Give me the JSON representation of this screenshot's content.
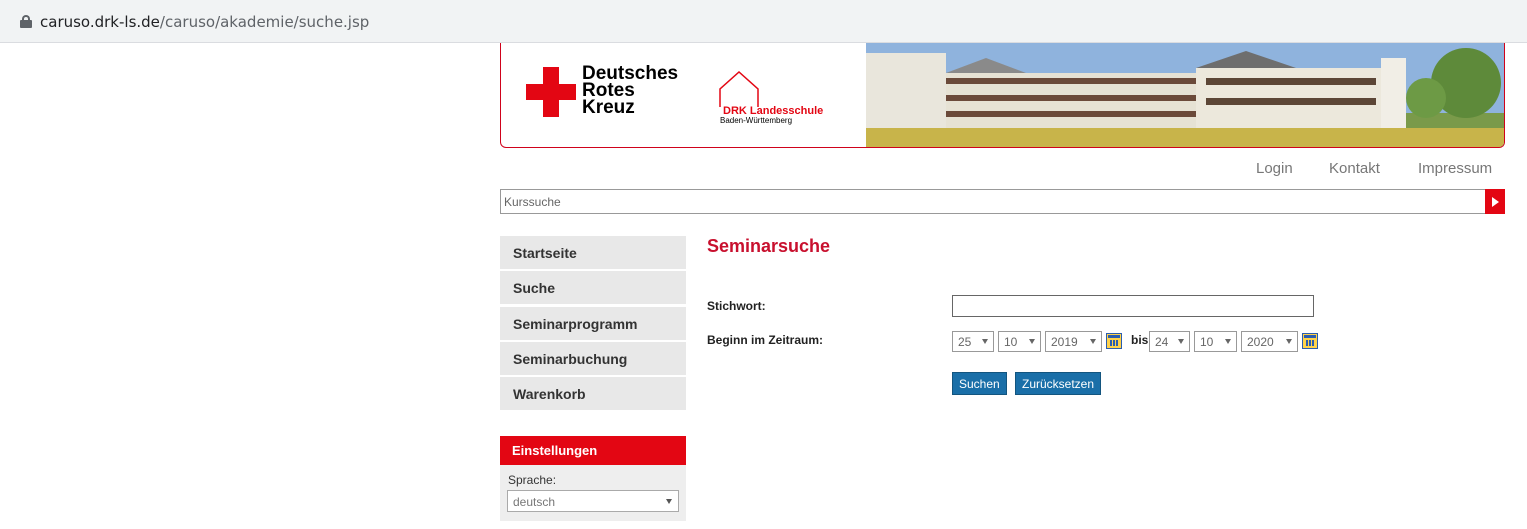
{
  "browser": {
    "url_domain": "caruso.drk-ls.de",
    "url_path": "/caruso/akademie/suche.jsp"
  },
  "header": {
    "org_line1": "Deutsches",
    "org_line2": "Rotes",
    "org_line3": "Kreuz",
    "school_name": "DRK Landesschule",
    "school_region": "Baden-Württemberg",
    "brand_color": "#e30613"
  },
  "top_links": {
    "login": "Login",
    "contact": "Kontakt",
    "imprint": "Impressum"
  },
  "search": {
    "placeholder": "Kurssuche"
  },
  "sidebar": {
    "items": [
      {
        "label": "Startseite"
      },
      {
        "label": "Suche"
      },
      {
        "label": "Seminarprogramm"
      },
      {
        "label": "Seminarbuchung"
      },
      {
        "label": "Warenkorb"
      }
    ],
    "settings": {
      "title": "Einstellungen",
      "language_label": "Sprache:",
      "language_value": "deutsch"
    }
  },
  "main": {
    "title": "Seminarsuche",
    "keyword_label": "Stichwort:",
    "keyword_value": "",
    "period_label": "Beginn im Zeitraum:",
    "from": {
      "day": "25",
      "month": "10",
      "year": "2019"
    },
    "between": "bis",
    "to": {
      "day": "24",
      "month": "10",
      "year": "2020"
    },
    "search_button": "Suchen",
    "reset_button": "Zurücksetzen"
  }
}
